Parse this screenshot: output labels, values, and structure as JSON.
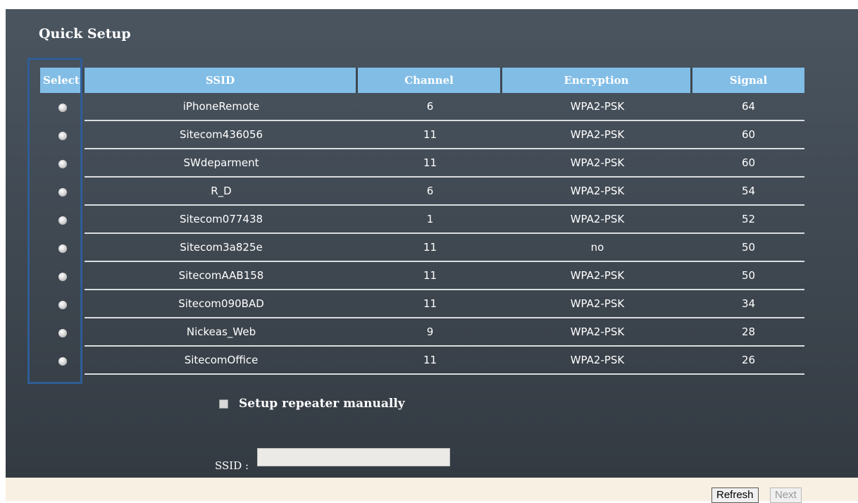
{
  "page": {
    "title": "Quick Setup"
  },
  "table": {
    "headers": [
      "Select",
      "SSID",
      "Channel",
      "Encryption",
      "Signal"
    ],
    "rows": [
      {
        "ssid": "iPhoneRemote",
        "channel": "6",
        "encryption": "WPA2-PSK",
        "signal": "64"
      },
      {
        "ssid": "Sitecom436056",
        "channel": "11",
        "encryption": "WPA2-PSK",
        "signal": "60"
      },
      {
        "ssid": "SWdeparment",
        "channel": "11",
        "encryption": "WPA2-PSK",
        "signal": "60"
      },
      {
        "ssid": "R_D",
        "channel": "6",
        "encryption": "WPA2-PSK",
        "signal": "54"
      },
      {
        "ssid": "Sitecom077438",
        "channel": "1",
        "encryption": "WPA2-PSK",
        "signal": "52"
      },
      {
        "ssid": "Sitecom3a825e",
        "channel": "11",
        "encryption": "no",
        "signal": "50"
      },
      {
        "ssid": "SitecomAAB158",
        "channel": "11",
        "encryption": "WPA2-PSK",
        "signal": "50"
      },
      {
        "ssid": "Sitecom090BAD",
        "channel": "11",
        "encryption": "WPA2-PSK",
        "signal": "34"
      },
      {
        "ssid": "Nickeas_Web",
        "channel": "9",
        "encryption": "WPA2-PSK",
        "signal": "28"
      },
      {
        "ssid": "SitecomOffice",
        "channel": "11",
        "encryption": "WPA2-PSK",
        "signal": "26"
      }
    ]
  },
  "manual": {
    "label": "Setup repeater manually",
    "checked": false
  },
  "ssid_field": {
    "label": "SSID :",
    "value": ""
  },
  "buttons": {
    "refresh": "Refresh",
    "next": "Next"
  }
}
